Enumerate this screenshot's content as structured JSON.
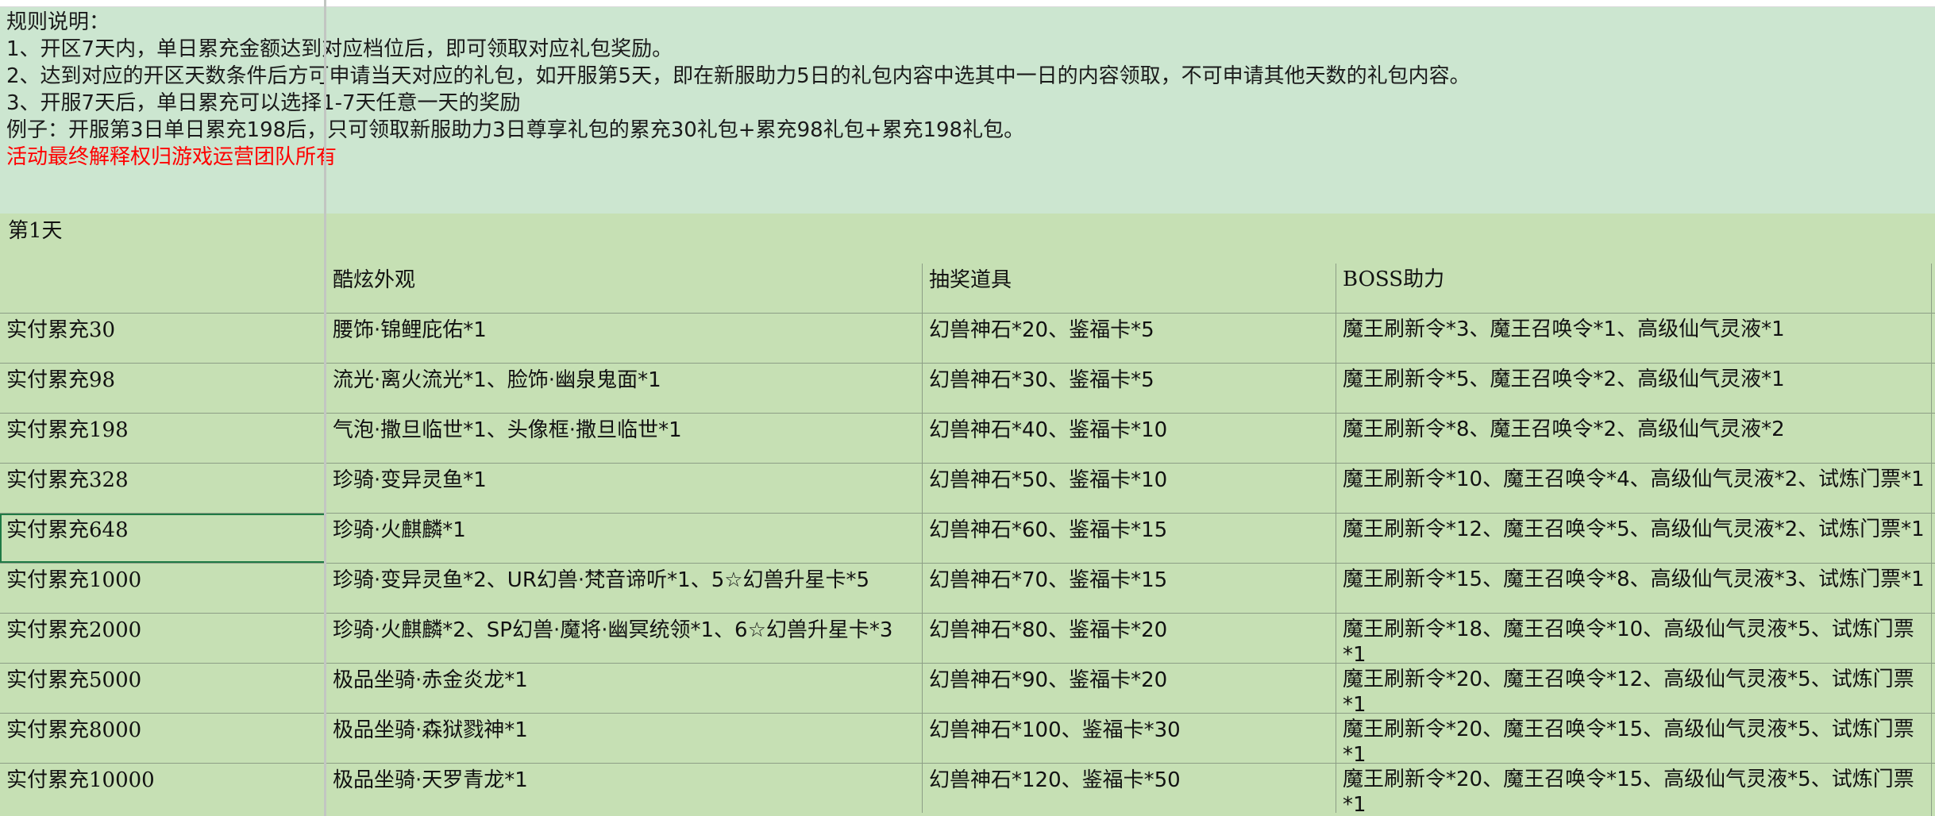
{
  "rules": {
    "title": "规则说明：",
    "line1": "1、开区7天内，单日累充金额达到对应档位后，即可领取对应礼包奖励。",
    "line2": "2、达到对应的开区天数条件后方可申请当天对应的礼包，如开服第5天，即在新服助力5日的礼包内容中选其中一日的内容领取，不可申请其他天数的礼包内容。",
    "line3": "3、开服7天后，单日累充可以选择1-7天任意一天的奖励",
    "example": "例子：开服第3日单日累充198后，只可领取新服助力3日尊享礼包的累充30礼包+累充98礼包+累充198礼包。",
    "notice": "活动最终解释权归游戏运营团队所有"
  },
  "day_label": "第1天",
  "headers": [
    "",
    "酷炫外观",
    "抽奖道具",
    "BOSS助力"
  ],
  "rows": [
    [
      "实付累充30",
      "腰饰·锦鲤庇佑*1",
      "幻兽神石*20、鉴福卡*5",
      "魔王刷新令*3、魔王召唤令*1、高级仙气灵液*1"
    ],
    [
      "实付累充98",
      "流光·离火流光*1、脸饰·幽泉鬼面*1",
      "幻兽神石*30、鉴福卡*5",
      "魔王刷新令*5、魔王召唤令*2、高级仙气灵液*1"
    ],
    [
      "实付累充198",
      "气泡·撒旦临世*1、头像框·撒旦临世*1",
      "幻兽神石*40、鉴福卡*10",
      "魔王刷新令*8、魔王召唤令*2、高级仙气灵液*2"
    ],
    [
      "实付累充328",
      "珍骑·变异灵鱼*1",
      "幻兽神石*50、鉴福卡*10",
      "魔王刷新令*10、魔王召唤令*4、高级仙气灵液*2、试炼门票*1"
    ],
    [
      "实付累充648",
      "珍骑·火麒麟*1",
      "幻兽神石*60、鉴福卡*15",
      "魔王刷新令*12、魔王召唤令*5、高级仙气灵液*2、试炼门票*1"
    ],
    [
      "实付累充1000",
      "珍骑·变异灵鱼*2、UR幻兽·梵音谛听*1、5☆幻兽升星卡*5",
      "幻兽神石*70、鉴福卡*15",
      "魔王刷新令*15、魔王召唤令*8、高级仙气灵液*3、试炼门票*1"
    ],
    [
      "实付累充2000",
      "珍骑·火麒麟*2、SP幻兽·魔将·幽冥统领*1、6☆幻兽升星卡*3",
      "幻兽神石*80、鉴福卡*20",
      "魔王刷新令*18、魔王召唤令*10、高级仙气灵液*5、试炼门票*1"
    ],
    [
      "实付累充5000",
      "极品坐骑·赤金炎龙*1",
      "幻兽神石*90、鉴福卡*20",
      "魔王刷新令*20、魔王召唤令*12、高级仙气灵液*5、试炼门票*1"
    ],
    [
      "实付累充8000",
      "极品坐骑·森狱戮神*1",
      "幻兽神石*100、鉴福卡*30",
      "魔王刷新令*20、魔王召唤令*15、高级仙气灵液*5、试炼门票*1"
    ],
    [
      "实付累充10000",
      "极品坐骑·天罗青龙*1",
      "幻兽神石*120、鉴福卡*50",
      "魔王刷新令*20、魔王召唤令*15、高级仙气灵液*5、试炼门票*1"
    ]
  ],
  "colors": {
    "sheet_bg": "#c6e0b4",
    "rules_bg": "#cce6d0",
    "notice_text": "#ff0000",
    "selection": "#1f7a45"
  }
}
